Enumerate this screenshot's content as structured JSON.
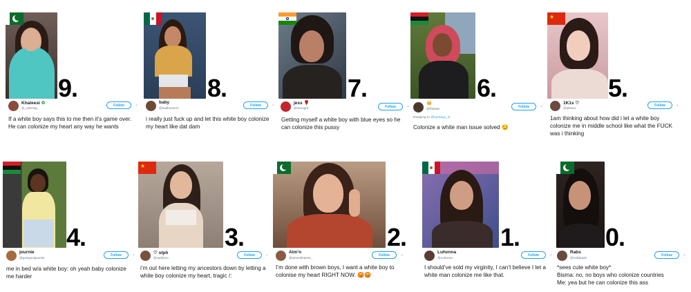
{
  "cards": [
    {
      "rank": "9.",
      "name": "Khaleesi",
      "badge": "♻",
      "handle": "@_aleezag",
      "follow": "Follow",
      "tweet": "If a white boy says this to me then it’s game over. He can colonize my heart any way he wants",
      "flag": "pakistan"
    },
    {
      "rank": "8.",
      "name": "baby",
      "handle": "@badbonezzz",
      "follow": "Follow",
      "tweet": "i really just fuck up and let this white boy colonize my heart like dat dam",
      "flag": "mexico"
    },
    {
      "rank": "7.",
      "name": "jess",
      "badge": "🌹",
      "handle": "@nenogrd",
      "follow": "Follow",
      "tweet": "Getting myself a white boy with blue eyes so he can colonize this pussy",
      "flag": "india"
    },
    {
      "rank": "6.",
      "name": "",
      "badge": "👑",
      "handle": "@Ridawn",
      "follow": "Follow",
      "reply_prefix": "Replying to",
      "reply_to": "@sumaya_in",
      "tweet": "Colonize a white man issue solved",
      "emoji": "😏",
      "flag": "african"
    },
    {
      "rank": "5.",
      "name": "1K1s ♡",
      "handle": "@aleeeu",
      "follow": "Follow",
      "tweet": "1am thinking about how did i let a white boy colonize me in middle school like what the FUCK was i thinking",
      "flag": "china"
    },
    {
      "rank": "4.",
      "name": "journie",
      "handle": "@goingonajournie",
      "follow": "Follow",
      "tweet": "me in bed w/a white boy: oh yeah baby colonize me harder",
      "flag": "african"
    },
    {
      "rank": "3.",
      "name": "♡ stph",
      "handle": "@sasfemo",
      "follow": "Follow",
      "tweet": "i’m out here letting my ancestors down by letting a white boy colonize my heart, tragic /:",
      "flag": "china"
    },
    {
      "rank": "2.",
      "name": "Aim’n",
      "handle": "@aimenkhanmr_",
      "follow": "Follow",
      "tweet": "I’m done with brown boys, I want a white boy to colonise my heart RIGHT NOW.",
      "emoji": "😡😡",
      "flag": "pakistan"
    },
    {
      "rank": "1.",
      "name": "Luhvnna",
      "handle": "@Luhvnna",
      "follow": "Follow",
      "tweet": "I should’ve sold my virginity, I can’t believe I let a white man colonize me like that.",
      "flag": "mexico"
    },
    {
      "rank": "0.",
      "name": "Rabs",
      "handle": "@nobilpaalr",
      "follow": "Follow",
      "tweet": "*sees cute white boy*\nBisma: no, no boys who colonize countries\nMe: yea but he can colonize this ass",
      "flag": "pakistan"
    }
  ],
  "colors": {
    "follow_blue": "#1da1f2",
    "handle_gray": "#657786",
    "text": "#14171a"
  }
}
